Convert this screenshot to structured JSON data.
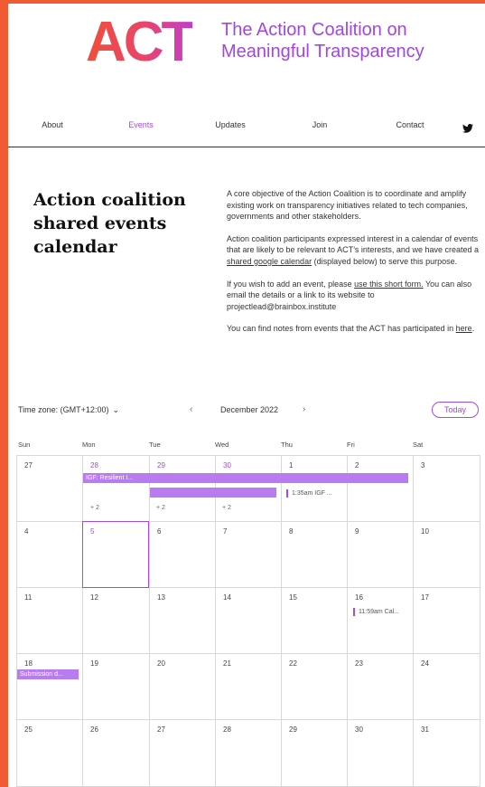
{
  "colors": {
    "accent": "#a24ae3",
    "frame": "#f05b34",
    "event_bar": "#b87cf0"
  },
  "logo": {
    "mark": "ACT",
    "line1": "The Action Coalition on",
    "line2": "Meaningful Transparency"
  },
  "nav": {
    "items": [
      {
        "label": "About",
        "active": false
      },
      {
        "label": "Events",
        "active": true
      },
      {
        "label": "Updates",
        "active": false
      },
      {
        "label": "Join",
        "active": false
      },
      {
        "label": "Contact",
        "active": false
      }
    ],
    "social_icon": "twitter-icon"
  },
  "heading": "Action coalition shared events calendar",
  "intro": {
    "p1": "A core objective of the Action Coalition is to coordinate and amplify existing work on transparency initiatives related to tech companies, governments and other stakeholders.",
    "p2a": "Action coalition participants expressed interest in a calendar of events that are likely to be relevant to ACT’s interests, and we have created a ",
    "p2link": "shared google calendar",
    "p2b": " (displayed below) to serve this purpose.",
    "p3a": "If you wish to add an event, please ",
    "p3link": "use this short form.",
    "p3b": " You can also email the details or a link to its website to projectlead@brainbox.institute",
    "p4a": "You can find notes from events that the ACT has participated in ",
    "p4link": "here",
    "p4b": "."
  },
  "toolbar": {
    "timezone": "Time zone: (GMT+12:00)",
    "prev": "‹",
    "month": "December 2022",
    "next": "›",
    "today": "Today"
  },
  "calendar": {
    "weekdays": [
      "Sun",
      "Mon",
      "Tue",
      "Wed",
      "Thu",
      "Fri",
      "Sat"
    ],
    "weeks": [
      [
        "27",
        "28",
        "29",
        "30",
        "1",
        "2",
        "3"
      ],
      [
        "4",
        "5",
        "6",
        "7",
        "8",
        "9",
        "10"
      ],
      [
        "11",
        "12",
        "13",
        "14",
        "15",
        "16",
        "17"
      ],
      [
        "18",
        "19",
        "20",
        "21",
        "22",
        "23",
        "24"
      ],
      [
        "25",
        "26",
        "27",
        "28",
        "29",
        "30",
        "31"
      ]
    ],
    "today": "5",
    "events": {
      "igf_bar": "IGF: Resilient I...",
      "igf_timed": "1:35am IGF ...",
      "more_mon": "+ 2",
      "more_tue": "+ 2",
      "more_wed": "+ 2",
      "fri16": "11:59am Cal...",
      "sun18": "Submission d..."
    }
  }
}
